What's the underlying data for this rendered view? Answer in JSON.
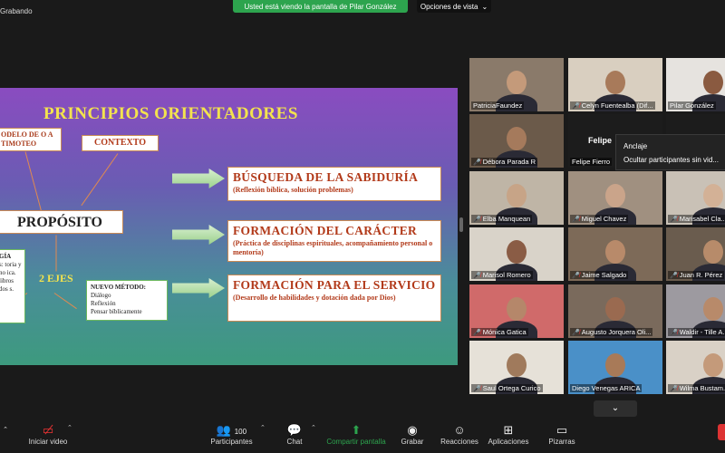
{
  "top": {
    "recording": "Grabando",
    "banner": "Usted está viendo la pantalla de Pilar González",
    "view_options": "Opciones de vista",
    "view_caret": "⌄"
  },
  "slide": {
    "title": "PRINCIPIOS ORIENTADORES",
    "modelo": "ODELO DE O A TIMOTEO",
    "contexto": "CONTEXTO",
    "proposito": "PROPÓSITO",
    "ejes": "2 EJES",
    "gia_head": "GÍA",
    "gia_text": "s: toria y no ica. libros dos s.",
    "metodo_head": "NUEVO MÉTODO:",
    "metodo_lines": [
      "Diálogo",
      "Reflexión",
      "Pensar bíblicamente"
    ],
    "p1_head": "BÚSQUEDA DE LA SABIDURÍA",
    "p1_sub": "(Reflexión bíblica, solución problemas)",
    "p2_head": "FORMACIÓN DEL CARÁCTER",
    "p2_sub": "(Práctica de disciplinas espirituales, acompañamiento personal o mentoría)",
    "p3_head": "FORMACIÓN PARA EL SERVICIO",
    "p3_sub": "(Desarrollo de habilidades y dotación dada por Dios)"
  },
  "gallery": {
    "participants": [
      {
        "name": "PatriciaFaundez",
        "muted": false,
        "bg": "#8a7a6a",
        "skin": "#c49a7a"
      },
      {
        "name": "Celyn Fuentealba (Dif...",
        "muted": true,
        "bg": "#d9cfc0",
        "skin": "#a87a5a"
      },
      {
        "name": "Pilar González",
        "muted": false,
        "bg": "#e6e3df",
        "skin": "#8a5a40",
        "active": true
      },
      {
        "name": "Débora Parada R",
        "muted": true,
        "bg": "#6b5a4a",
        "skin": "#a57a5c"
      },
      {
        "name": "Felipe Fierro",
        "muted": false,
        "bg": "#1c1c1c",
        "skin": "#1c1c1c",
        "label_center": "Felipe"
      },
      {
        "name": "",
        "muted": false,
        "bg": "#1c1c1c",
        "skin": "#1c1c1c"
      },
      {
        "name": "Elba Manquean",
        "muted": true,
        "bg": "#bfb5a6",
        "skin": "#c7a487"
      },
      {
        "name": "Miguel Chavez",
        "muted": true,
        "bg": "#a09080",
        "skin": "#caa48a"
      },
      {
        "name": "Marisabel Cla...",
        "muted": true,
        "bg": "#c9c1b6",
        "skin": "#d3b196"
      },
      {
        "name": "Marisol Romero",
        "muted": true,
        "bg": "#d9d3c9",
        "skin": "#8a5c45"
      },
      {
        "name": "Jaime Salgado",
        "muted": true,
        "bg": "#7d6a58",
        "skin": "#b88a6a"
      },
      {
        "name": "Juan R. Pérez",
        "muted": true,
        "bg": "#6a5c4e",
        "skin": "#b78b6a"
      },
      {
        "name": "Mónica Gatica",
        "muted": true,
        "bg": "#d06a6a",
        "skin": "#b5876a"
      },
      {
        "name": "Augusto Jorquera Oli...",
        "muted": true,
        "bg": "#7a6a5c",
        "skin": "#9a6a50"
      },
      {
        "name": "Waldir - Tille A...",
        "muted": true,
        "bg": "#9d9aa0",
        "skin": "#b88a6a"
      },
      {
        "name": "Saul Ortega Curico",
        "muted": true,
        "bg": "#e6e1d8",
        "skin": "#a07a5c"
      },
      {
        "name": "Diego Venegas ARICA",
        "muted": false,
        "bg": "#4a90c8",
        "skin": "#a87a58"
      },
      {
        "name": "Wilma Bustam...",
        "muted": true,
        "bg": "#d9d1c6",
        "skin": "#c49a7a"
      }
    ],
    "context_menu": [
      "Anclaje",
      "Ocultar participantes sin vid..."
    ],
    "collapse_icon": "⌄"
  },
  "toolbar": {
    "video_label": "Iniciar video",
    "participants_label": "Participantes",
    "participants_count": "100",
    "chat_label": "Chat",
    "share_label": "Compartir pantalla",
    "record_label": "Grabar",
    "reactions_label": "Reacciones",
    "apps_label": "Aplicaciones",
    "whiteboard_label": "Pizarras"
  }
}
